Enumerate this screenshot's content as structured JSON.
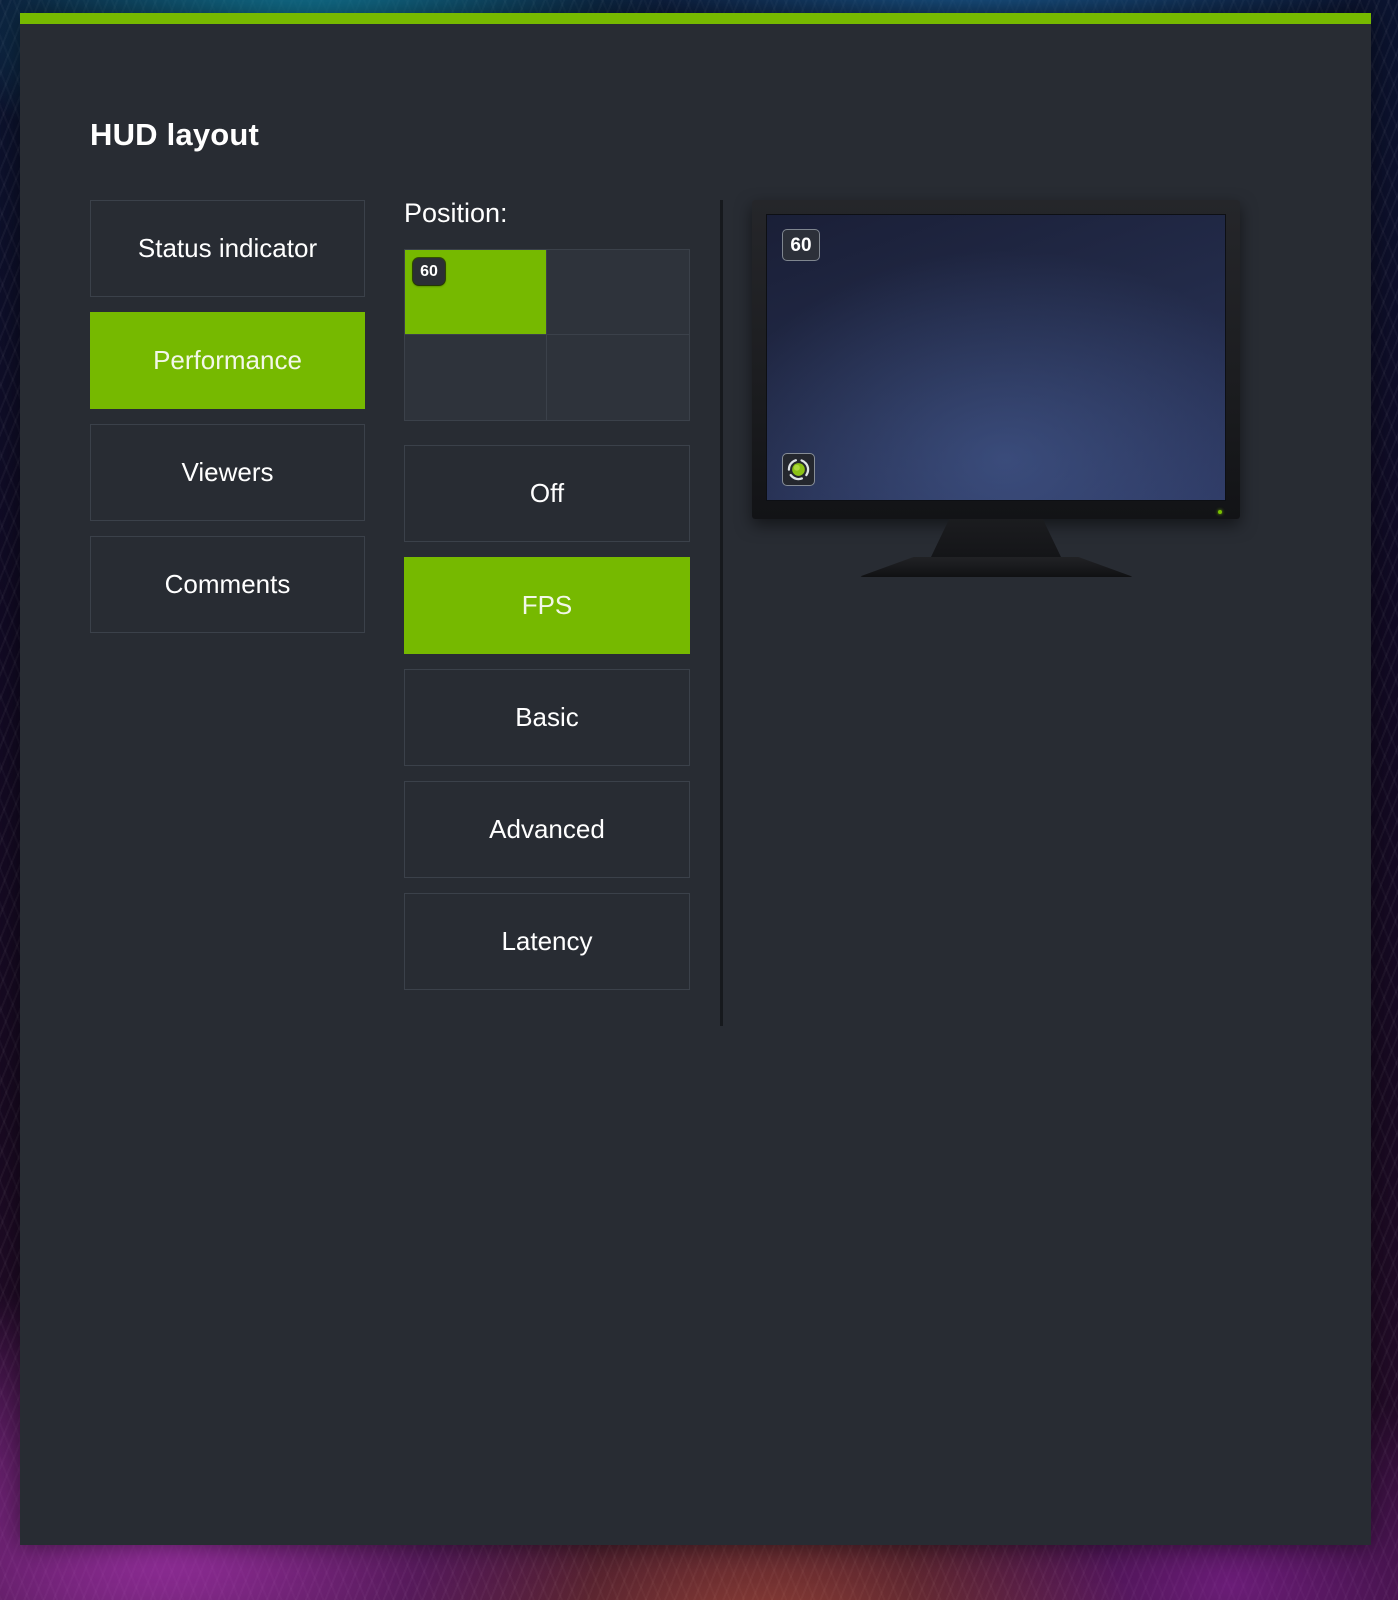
{
  "app": {
    "accent_color": "#76b900",
    "panel_bg": "#282c33",
    "title": "HUD layout"
  },
  "sidebar": {
    "items": [
      {
        "label": "Status indicator",
        "selected": false
      },
      {
        "label": "Performance",
        "selected": true
      },
      {
        "label": "Viewers",
        "selected": false
      },
      {
        "label": "Comments",
        "selected": false
      }
    ]
  },
  "position": {
    "label": "Position:",
    "cells": [
      {
        "name": "top-left",
        "selected": true,
        "chip": "60"
      },
      {
        "name": "top-right",
        "selected": false,
        "chip": ""
      },
      {
        "name": "bottom-left",
        "selected": false,
        "chip": ""
      },
      {
        "name": "bottom-right",
        "selected": false,
        "chip": ""
      }
    ]
  },
  "modes": {
    "items": [
      {
        "label": "Off",
        "selected": false
      },
      {
        "label": "FPS",
        "selected": true
      },
      {
        "label": "Basic",
        "selected": false
      },
      {
        "label": "Advanced",
        "selected": false
      },
      {
        "label": "Latency",
        "selected": false
      }
    ]
  },
  "preview": {
    "fps_chip": "60",
    "status_icon": "nvidia-status-indicator-icon",
    "screen_overlay_position": "top-left"
  }
}
